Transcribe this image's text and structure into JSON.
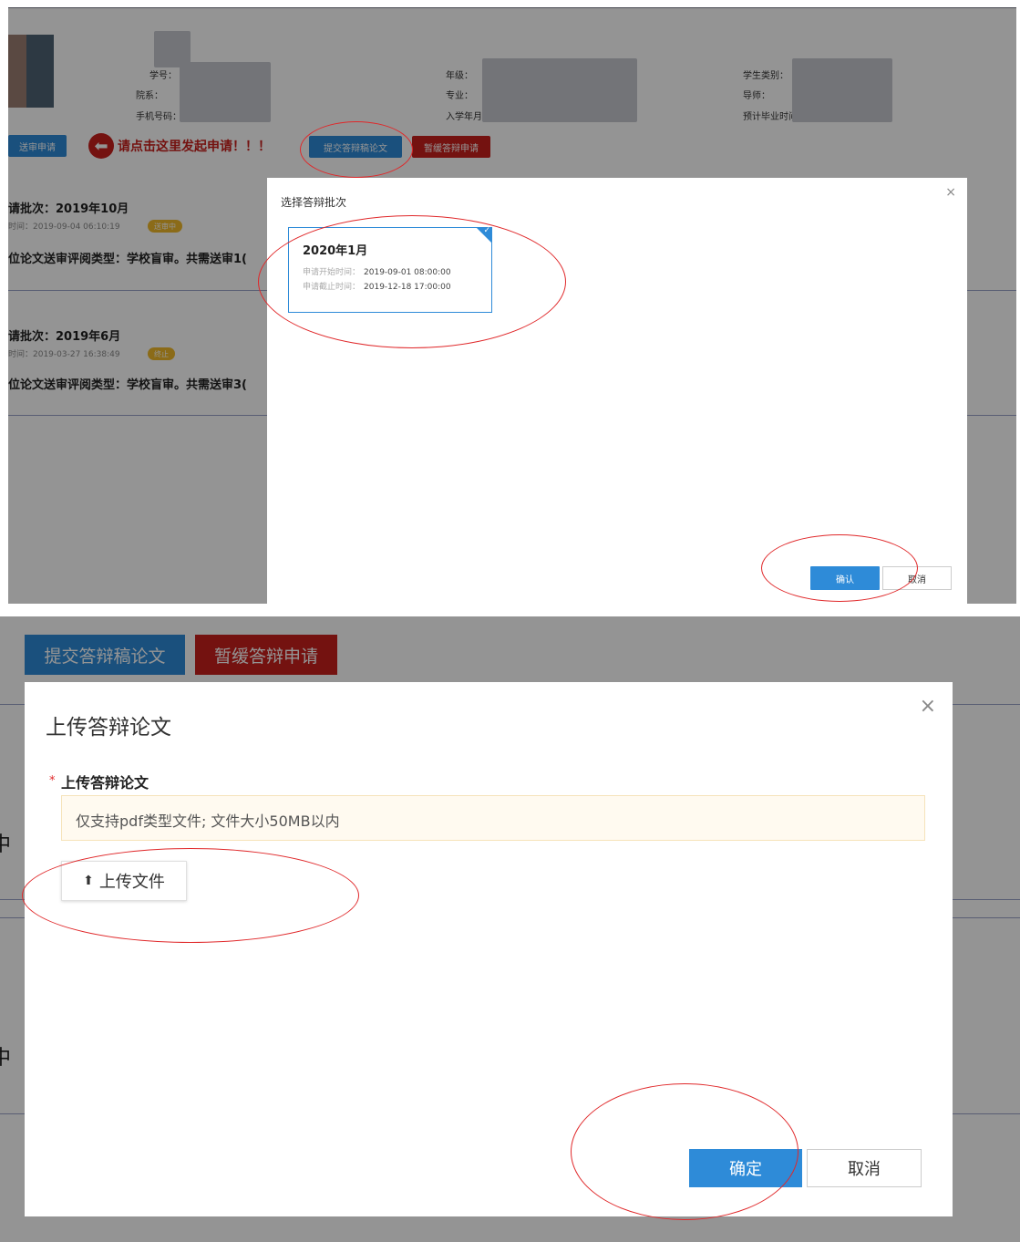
{
  "panel1": {
    "student_info": {
      "labels": [
        "学号：",
        "院系：",
        "手机号码：",
        "年级：",
        "专业：",
        "入学年月：",
        "学生类别：",
        "导师：",
        "预计毕业时间："
      ]
    },
    "actions": {
      "send_review_button": "送审申请",
      "cta_text": "请点击这里发起申请！！！",
      "submit_defense_button": "提交答辩稿论文",
      "postpone_defense_button": "暂缓答辩申请"
    },
    "records": [
      {
        "title": "请批次：2019年10月",
        "time": "时间：2019-09-04 06:10:19",
        "badge": "送审中",
        "desc": "位论文送审评阅类型：学校盲审。共需送审1("
      },
      {
        "title": "请批次：2019年6月",
        "time": "时间：2019-03-27 16:38:49",
        "badge": "终止",
        "desc": "位论文送审评阅类型：学校盲审。共需送审3("
      }
    ],
    "dialog": {
      "title": "选择答辩批次",
      "close_icon": "×",
      "batch": {
        "name": "2020年1月",
        "start_label": "申请开始时间：",
        "start_value": "2019-09-01 08:00:00",
        "end_label": "申请截止时间：",
        "end_value": "2019-12-18 17:00:00",
        "check_icon": "✓"
      },
      "confirm_button": "确认",
      "cancel_button": "取消"
    }
  },
  "panel2": {
    "submit_defense_button": "提交答辩稿论文",
    "postpone_defense_button": "暂缓答辩申请",
    "side_chars": [
      "中",
      "中"
    ],
    "dialog": {
      "title": "上传答辩论文",
      "close_icon": "×",
      "required_mark": "*",
      "field_label": "上传答辩论文",
      "hint": "仅支持pdf类型文件; 文件大小50MB以内",
      "upload_icon": "⬆",
      "upload_button": "上传文件",
      "ok_button": "确定",
      "cancel_button": "取消"
    }
  },
  "colors": {
    "primary": "#2e8bd8",
    "danger": "#c9201c",
    "warning_badge": "#f0b92a",
    "annotation": "#e0282a"
  }
}
